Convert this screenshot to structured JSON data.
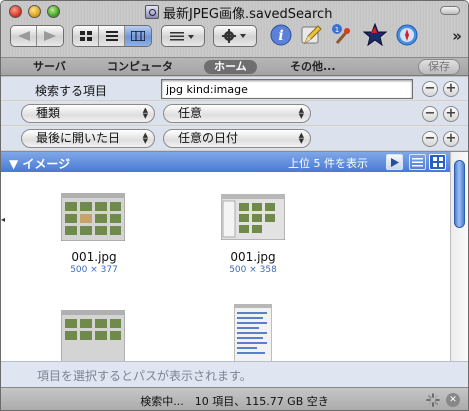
{
  "window": {
    "title": "最新JPEG画像.savedSearch"
  },
  "toolbar": {
    "items": [
      "back-forward",
      "view-icon",
      "view-list",
      "view-column",
      "arrange",
      "action",
      "info",
      "edit",
      "app",
      "imovie",
      "safari"
    ],
    "overflow_icon": "»"
  },
  "scope": {
    "tabs": [
      "サーバ",
      "コンピュータ",
      "ホーム",
      "その他..."
    ],
    "active": "ホーム",
    "save_label": "保存"
  },
  "criteria": [
    {
      "label": "検索する項目",
      "type": "text",
      "value": "jpg kind:image"
    },
    {
      "attribute": "種類",
      "operator": "任意"
    },
    {
      "attribute": "最後に開いた日",
      "operator": "任意の日付"
    }
  ],
  "results": {
    "group_title": "▼ イメージ",
    "count_label": "上位 5 件を表示",
    "items": [
      {
        "name": "001.jpg",
        "dimensions": "500 × 377"
      },
      {
        "name": "001.jpg",
        "dimensions": "500 × 358"
      },
      {
        "name": "",
        "dimensions": ""
      },
      {
        "name": "",
        "dimensions": ""
      }
    ]
  },
  "pathbar": {
    "hint": "項目を選択するとパスが表示されます。"
  },
  "status": {
    "text": "検索中...　10 項目、115.77 GB 空き"
  },
  "colors": {
    "accent": "#4a79d4",
    "path_text": "#7a8494"
  }
}
